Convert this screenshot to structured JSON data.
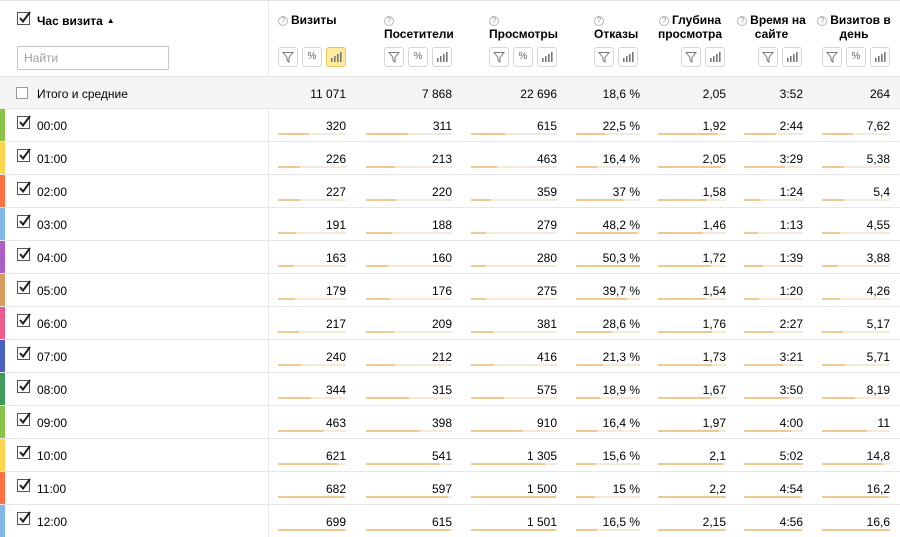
{
  "header": {
    "dimension_label": "Час визита",
    "sort_indicator": "▲",
    "search_placeholder": "Найти",
    "columns": [
      {
        "label": "Визиты",
        "help": "?",
        "pct": "%"
      },
      {
        "label": "Посетители",
        "help": "?",
        "pct": "%"
      },
      {
        "label": "Просмотры",
        "help": "?",
        "pct": "%"
      },
      {
        "label": "Отказы",
        "help": "?"
      },
      {
        "label": "Глубина просмотра",
        "help": "?"
      },
      {
        "label": "Время на сайте",
        "help": "?"
      },
      {
        "label": "Визитов в день",
        "help": "?",
        "pct": "%"
      }
    ]
  },
  "totals": {
    "label": "Итого и средние",
    "values": [
      "11 071",
      "7 868",
      "22 696",
      "18,6 %",
      "2,05",
      "3:52",
      "264"
    ]
  },
  "rows": [
    {
      "hour": "00:00",
      "color": "#8bc34a",
      "values": [
        "320",
        "311",
        "615",
        "22,5 %",
        "1,92",
        "2:44",
        "7,62"
      ]
    },
    {
      "hour": "01:00",
      "color": "#ffd54f",
      "values": [
        "226",
        "213",
        "463",
        "16,4 %",
        "2,05",
        "3:29",
        "5,38"
      ]
    },
    {
      "hour": "02:00",
      "color": "#ff7043",
      "values": [
        "227",
        "220",
        "359",
        "37 %",
        "1,58",
        "1:24",
        "5,4"
      ]
    },
    {
      "hour": "03:00",
      "color": "#81b8e8",
      "values": [
        "191",
        "188",
        "279",
        "48,2 %",
        "1,46",
        "1:13",
        "4,55"
      ]
    },
    {
      "hour": "04:00",
      "color": "#ab5fc5",
      "values": [
        "163",
        "160",
        "280",
        "50,3 %",
        "1,72",
        "1:39",
        "3,88"
      ]
    },
    {
      "hour": "05:00",
      "color": "#d99a5e",
      "values": [
        "179",
        "176",
        "275",
        "39,7 %",
        "1,54",
        "1:20",
        "4,26"
      ]
    },
    {
      "hour": "06:00",
      "color": "#ee5b8e",
      "values": [
        "217",
        "209",
        "381",
        "28,6 %",
        "1,76",
        "2:27",
        "5,17"
      ]
    },
    {
      "hour": "07:00",
      "color": "#4a63c2",
      "values": [
        "240",
        "212",
        "416",
        "21,3 %",
        "1,73",
        "3:21",
        "5,71"
      ]
    },
    {
      "hour": "08:00",
      "color": "#3e9b5a",
      "values": [
        "344",
        "315",
        "575",
        "18,9 %",
        "1,67",
        "3:50",
        "8,19"
      ]
    },
    {
      "hour": "09:00",
      "color": "#8bc34a",
      "values": [
        "463",
        "398",
        "910",
        "16,4 %",
        "1,97",
        "4:00",
        "11"
      ]
    },
    {
      "hour": "10:00",
      "color": "#ffd54f",
      "values": [
        "621",
        "541",
        "1 305",
        "15,6 %",
        "2,1",
        "5:02",
        "14,8"
      ]
    },
    {
      "hour": "11:00",
      "color": "#ff7043",
      "values": [
        "682",
        "597",
        "1 500",
        "15 %",
        "2,2",
        "4:54",
        "16,2"
      ]
    },
    {
      "hour": "12:00",
      "color": "#81b8e8",
      "values": [
        "699",
        "615",
        "1 501",
        "16,5 %",
        "2,15",
        "4:56",
        "16,6"
      ]
    }
  ],
  "bar_fractions": [
    [
      0.45,
      0.49,
      0.4,
      0.45,
      0.87,
      0.54,
      0.46
    ],
    [
      0.32,
      0.34,
      0.3,
      0.33,
      0.93,
      0.69,
      0.32
    ],
    [
      0.32,
      0.35,
      0.23,
      0.74,
      0.72,
      0.28,
      0.33
    ],
    [
      0.27,
      0.3,
      0.18,
      0.96,
      0.66,
      0.24,
      0.27
    ],
    [
      0.23,
      0.25,
      0.18,
      1.0,
      0.78,
      0.33,
      0.23
    ],
    [
      0.25,
      0.28,
      0.18,
      0.79,
      0.7,
      0.26,
      0.26
    ],
    [
      0.31,
      0.33,
      0.25,
      0.57,
      0.8,
      0.49,
      0.31
    ],
    [
      0.34,
      0.34,
      0.27,
      0.42,
      0.79,
      0.66,
      0.34
    ],
    [
      0.49,
      0.5,
      0.38,
      0.38,
      0.76,
      0.76,
      0.49
    ],
    [
      0.66,
      0.63,
      0.6,
      0.33,
      0.9,
      0.79,
      0.66
    ],
    [
      0.88,
      0.86,
      0.86,
      0.31,
      0.95,
      1.0,
      0.89
    ],
    [
      0.97,
      0.95,
      0.99,
      0.3,
      1.0,
      0.97,
      0.97
    ],
    [
      0.99,
      0.98,
      0.99,
      0.33,
      0.98,
      0.98,
      1.0
    ]
  ]
}
